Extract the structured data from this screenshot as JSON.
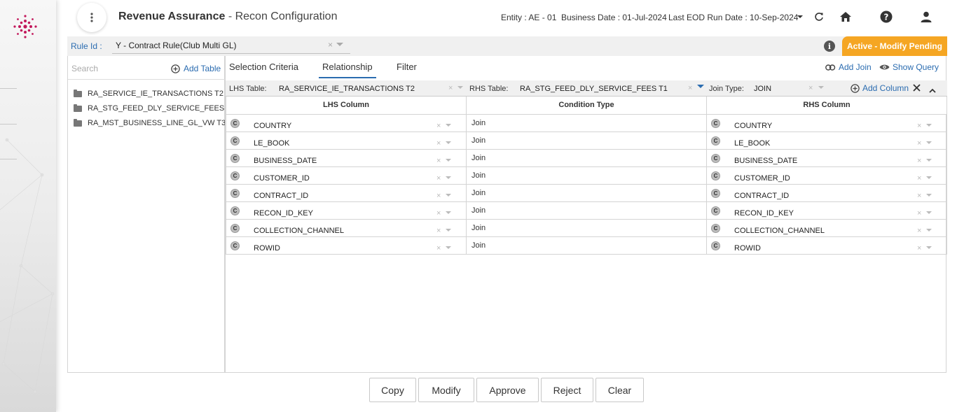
{
  "app": {
    "title": "Revenue Assurance",
    "separator": " - ",
    "subtitle": "Recon Configuration"
  },
  "header": {
    "entity": "Entity : AE - 01",
    "business_date": "Business Date : 01-Jul-2024",
    "last_eod": "Last EOD Run Date : 10-Sep-2024"
  },
  "icons": {
    "kebab": "more-vert-icon",
    "refresh": "refresh-icon",
    "home": "home-icon",
    "help": "help-icon",
    "user": "person-icon",
    "brand_color": "#c2185b"
  },
  "rule": {
    "label": "Rule Id :",
    "value": "Y - Contract Rule(Club Multi GL)",
    "clear": "×",
    "status": "Active - Modify Pending",
    "status_color": "#f5a623",
    "info": "i"
  },
  "sidebar": {
    "search_placeholder": "Search",
    "add_table": "Add Table",
    "tables": [
      "RA_SERVICE_IE_TRANSACTIONS T2",
      "RA_STG_FEED_DLY_SERVICE_FEES T ...",
      "RA_MST_BUSINESS_LINE_GL_VW T3"
    ]
  },
  "tabs": [
    {
      "label": "Selection Criteria"
    },
    {
      "label": "Relationship"
    },
    {
      "label": "Filter"
    }
  ],
  "actions": {
    "add_join": "Add Join",
    "show_query": "Show Query",
    "add_column": "Add Column"
  },
  "selectors": {
    "lhs_label": "LHS Table:",
    "lhs_value": "RA_SERVICE_IE_TRANSACTIONS T2",
    "rhs_label": "RHS Table:",
    "rhs_value": "RA_STG_FEED_DLY_SERVICE_FEES T1",
    "join_label": "Join Type:",
    "join_value": "JOIN"
  },
  "grid": {
    "headers": [
      "LHS Column",
      "Condition Type",
      "RHS Column"
    ],
    "badge": "C",
    "rows": [
      {
        "lhs": "COUNTRY",
        "cond": "Join",
        "rhs": "COUNTRY"
      },
      {
        "lhs": "LE_BOOK",
        "cond": "Join",
        "rhs": "LE_BOOK"
      },
      {
        "lhs": "BUSINESS_DATE",
        "cond": "Join",
        "rhs": "BUSINESS_DATE"
      },
      {
        "lhs": "CUSTOMER_ID",
        "cond": "Join",
        "rhs": "CUSTOMER_ID"
      },
      {
        "lhs": "CONTRACT_ID",
        "cond": "Join",
        "rhs": "CONTRACT_ID"
      },
      {
        "lhs": "RECON_ID_KEY",
        "cond": "Join",
        "rhs": "RECON_ID_KEY"
      },
      {
        "lhs": "COLLECTION_CHANNEL",
        "cond": "Join",
        "rhs": "COLLECTION_CHANNEL"
      },
      {
        "lhs": "ROWID",
        "cond": "Join",
        "rhs": "ROWID"
      }
    ]
  },
  "footer_buttons": [
    "Copy",
    "Modify",
    "Approve",
    "Reject",
    "Clear"
  ]
}
